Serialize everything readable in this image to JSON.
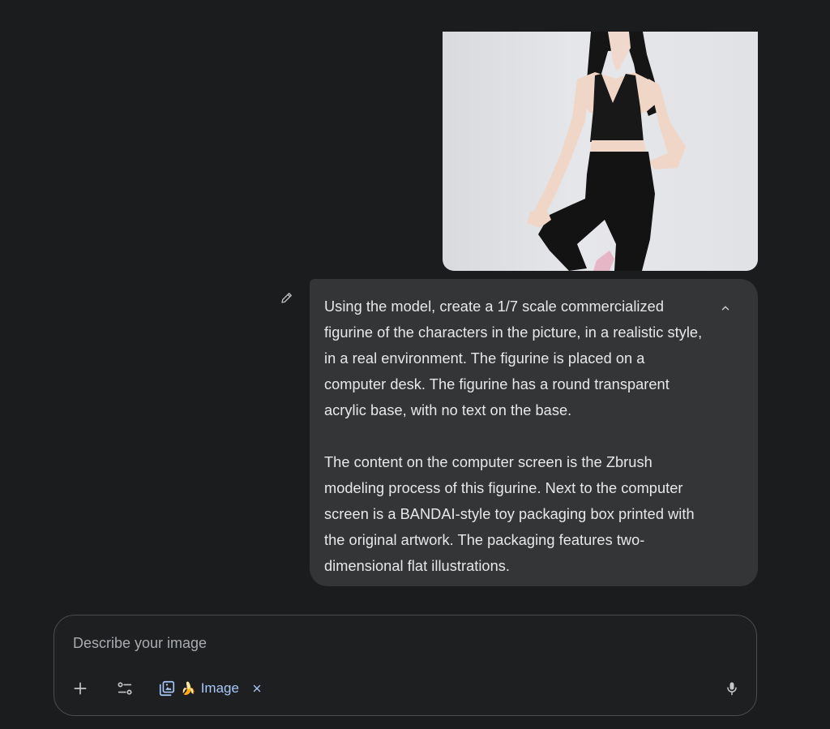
{
  "message": {
    "paragraphs": [
      "Using the model, create a 1/7 scale commercialized figurine of the characters in the picture, in a realistic style, in a real environment. The figurine is placed on a computer desk. The figurine has a round transparent acrylic base, with no text on the base.",
      "The content on the computer screen is the Zbrush modeling process of this figurine. Next to the computer screen is a BANDAI-style toy packaging box printed with the original artwork. The packaging features two-dimensional flat illustrations."
    ],
    "attachment_icon": "uploaded-photo",
    "edit_icon": "pencil-icon",
    "collapse_icon": "chevron-up-icon"
  },
  "composer": {
    "placeholder": "Describe your image",
    "chip_label": "Image",
    "chip_emoji": "🍌",
    "icons": [
      "plus-icon",
      "tune-icon",
      "image-gen-icon",
      "close-icon",
      "mic-icon"
    ]
  },
  "colors": {
    "background": "#1b1c1d",
    "bubble": "#333537",
    "accent": "#a8c7fa"
  }
}
